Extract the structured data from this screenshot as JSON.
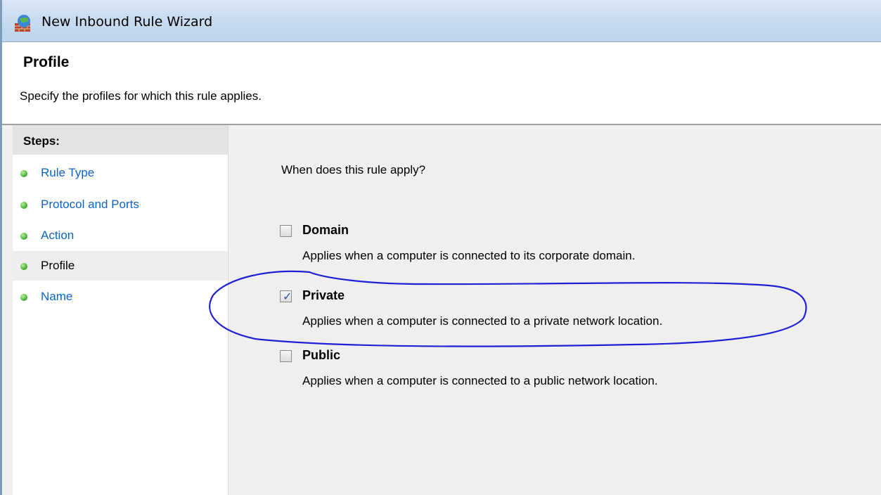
{
  "window": {
    "title": "New Inbound Rule Wizard"
  },
  "header": {
    "title": "Profile",
    "description": "Specify the profiles for which this rule applies."
  },
  "steps": {
    "heading": "Steps:",
    "items": [
      {
        "label": "Rule Type",
        "current": false
      },
      {
        "label": "Protocol and Ports",
        "current": false
      },
      {
        "label": "Action",
        "current": false
      },
      {
        "label": "Profile",
        "current": true
      },
      {
        "label": "Name",
        "current": false
      }
    ]
  },
  "content": {
    "question": "When does this rule apply?",
    "options": [
      {
        "label": "Domain",
        "description": "Applies when a computer is connected to its corporate domain.",
        "checked": false
      },
      {
        "label": "Private",
        "description": "Applies when a computer is connected to a private network location.",
        "checked": true
      },
      {
        "label": "Public",
        "description": "Applies when a computer is connected to a public network location.",
        "checked": false
      }
    ]
  },
  "annotation": {
    "color": "#1f1fd6",
    "encircles": "Private"
  },
  "icons": {
    "title_icon": "firewall-icon",
    "step_bullet": "green-dot-icon",
    "checkmark": "checkmark-icon"
  }
}
